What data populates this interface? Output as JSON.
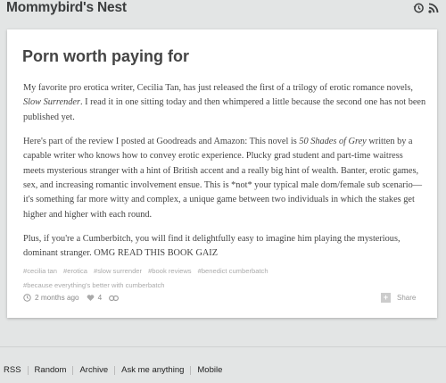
{
  "header": {
    "blog_title": "Mommybird's Nest",
    "icons": [
      "history-icon",
      "rss-icon"
    ]
  },
  "post": {
    "title": "Porn worth paying for",
    "p1": {
      "a": "My favorite pro erotica writer, Cecilia Tan, has just released the first of a trilogy of erotic romance novels, ",
      "b": "Slow Surrender",
      "c": ". I read it in one sitting today and then whimpered a little because the second one has not been published yet."
    },
    "p2": {
      "a": "Here's part of the review I posted at Goodreads and Amazon: This novel is ",
      "b": "50 Shades of Grey",
      "c": " written by a capable writer who knows how to convey erotic experience. Plucky grad student and part-time waitress meets mysterious stranger with a hint of British accent and a really big hint of wealth. Banter, erotic games, sex, and increasing romantic involvement ensue. This is *not* your typical male dom/female sub scenario—it's something far more witty and complex, a unique game between two individuals in which the stakes get higher and higher with each round."
    },
    "p3": "Plus, if you're a Cumberbitch, you will find it delightfully easy to imagine him playing the mysterious, dominant stranger. OMG READ THIS BOOK GAIZ",
    "tags": [
      "#cecilia tan",
      "#erotica",
      "#slow surrender",
      "#book reviews",
      "#benedict cumberbatch",
      "#because everything's better with cumberbatch"
    ],
    "timestamp": "2 months ago",
    "likes": "4",
    "share_label": "Share"
  },
  "footer_nav": [
    "RSS",
    "Random",
    "Archive",
    "Ask me anything",
    "Mobile"
  ],
  "colors": {
    "background": "#e3e5e5",
    "card": "#ffffff",
    "title": "#3b3d3e"
  }
}
